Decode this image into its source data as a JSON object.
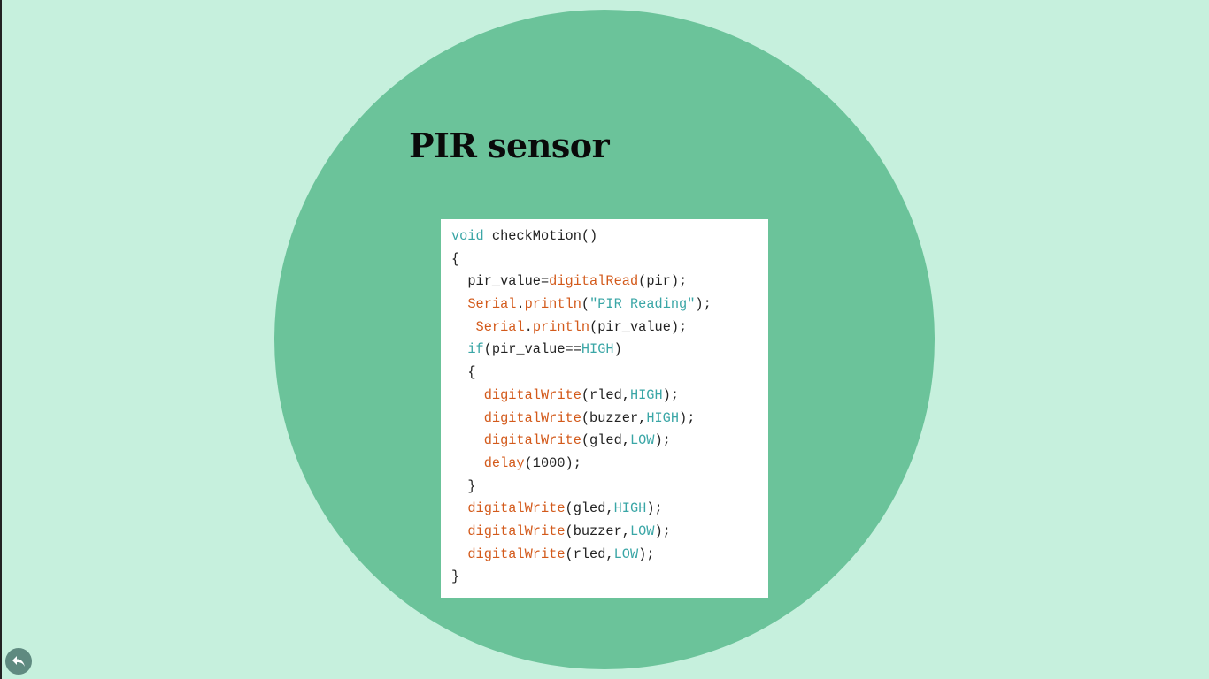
{
  "slide": {
    "title": "PIR sensor",
    "colors": {
      "background": "#c6f0dd",
      "circle": "#6bc39a",
      "keyword": "#3aa6a6",
      "function": "#d35a1b",
      "constant": "#3aa6a6",
      "plain": "#222222",
      "string": "#3aa6a6"
    }
  },
  "code": {
    "lines": [
      [
        [
          "void",
          "keyword"
        ],
        [
          " checkMotion()",
          "plain"
        ]
      ],
      [
        [
          "{",
          "plain"
        ]
      ],
      [
        [
          "  pir_value=",
          "plain"
        ],
        [
          "digitalRead",
          "function"
        ],
        [
          "(pir);",
          "plain"
        ]
      ],
      [
        [
          "  ",
          "plain"
        ],
        [
          "Serial",
          "function"
        ],
        [
          ".",
          "plain"
        ],
        [
          "println",
          "function"
        ],
        [
          "(",
          "plain"
        ],
        [
          "\"PIR Reading\"",
          "string"
        ],
        [
          ");",
          "plain"
        ]
      ],
      [
        [
          "   ",
          "plain"
        ],
        [
          "Serial",
          "function"
        ],
        [
          ".",
          "plain"
        ],
        [
          "println",
          "function"
        ],
        [
          "(pir_value);",
          "plain"
        ]
      ],
      [
        [
          "  ",
          "plain"
        ],
        [
          "if",
          "keyword"
        ],
        [
          "(pir_value==",
          "plain"
        ],
        [
          "HIGH",
          "constant"
        ],
        [
          ")",
          "plain"
        ]
      ],
      [
        [
          "  {",
          "plain"
        ]
      ],
      [
        [
          "    ",
          "plain"
        ],
        [
          "digitalWrite",
          "function"
        ],
        [
          "(rled,",
          "plain"
        ],
        [
          "HIGH",
          "constant"
        ],
        [
          ");",
          "plain"
        ]
      ],
      [
        [
          "    ",
          "plain"
        ],
        [
          "digitalWrite",
          "function"
        ],
        [
          "(buzzer,",
          "plain"
        ],
        [
          "HIGH",
          "constant"
        ],
        [
          ");",
          "plain"
        ]
      ],
      [
        [
          "    ",
          "plain"
        ],
        [
          "digitalWrite",
          "function"
        ],
        [
          "(gled,",
          "plain"
        ],
        [
          "LOW",
          "constant"
        ],
        [
          ");",
          "plain"
        ]
      ],
      [
        [
          "    ",
          "plain"
        ],
        [
          "delay",
          "function"
        ],
        [
          "(1000);",
          "plain"
        ]
      ],
      [
        [
          "  }",
          "plain"
        ]
      ],
      [
        [
          "  ",
          "plain"
        ],
        [
          "digitalWrite",
          "function"
        ],
        [
          "(gled,",
          "plain"
        ],
        [
          "HIGH",
          "constant"
        ],
        [
          ");",
          "plain"
        ]
      ],
      [
        [
          "  ",
          "plain"
        ],
        [
          "digitalWrite",
          "function"
        ],
        [
          "(buzzer,",
          "plain"
        ],
        [
          "LOW",
          "constant"
        ],
        [
          ");",
          "plain"
        ]
      ],
      [
        [
          "  ",
          "plain"
        ],
        [
          "digitalWrite",
          "function"
        ],
        [
          "(rled,",
          "plain"
        ],
        [
          "LOW",
          "constant"
        ],
        [
          ");",
          "plain"
        ]
      ],
      [
        [
          "}",
          "plain"
        ]
      ]
    ]
  },
  "nav": {
    "back_icon": "back-arrow-icon"
  }
}
